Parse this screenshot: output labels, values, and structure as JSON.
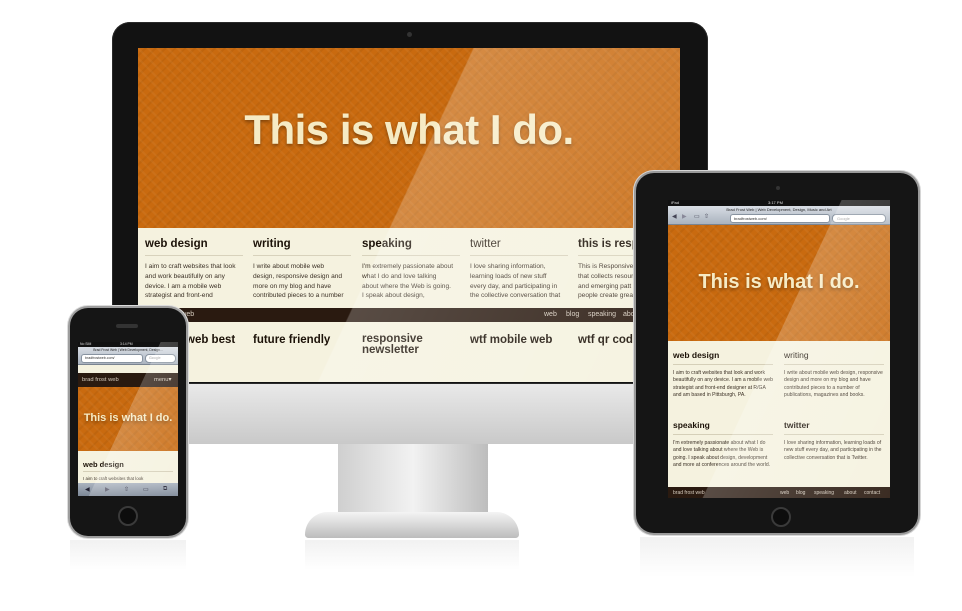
{
  "hero_text": "This is what I do.",
  "desktop": {
    "columns": [
      {
        "title": "web design",
        "lines": [
          "I aim to craft websites that look",
          "and work beautifully on any",
          "device. I am a mobile web",
          "strategist and front-end"
        ]
      },
      {
        "title": "writing",
        "lines": [
          "I write about mobile web",
          "design, responsive design and",
          "more on my blog and have",
          "contributed pieces to a number"
        ]
      },
      {
        "title": "speaking",
        "lines": [
          "I'm extremely passionate about",
          "what I do and love talking",
          "about where the Web is going.",
          "I speak about design,"
        ]
      },
      {
        "title": "twitter",
        "lines": [
          "I love sharing information,",
          "learning loads of new stuff",
          "every day, and participating in",
          "the collective conversation that"
        ]
      },
      {
        "title": "this is resp",
        "lines": [
          "This is Responsive",
          "that collects resourc",
          "and emerging patt",
          "people create great"
        ]
      }
    ],
    "nav_brand": "ost web",
    "nav_links": [
      "web",
      "blog",
      "speaking",
      "abo"
    ],
    "lower_headings": [
      "web best",
      "future friendly",
      "responsive newsletter",
      "wtf mobile web",
      "wtf qr code"
    ]
  },
  "ipad": {
    "status_left": "iPad",
    "status_time": "3:17 PM",
    "page_title": "Brad Frost Web | Web Development, Design, Music and Art",
    "url": "bradfrostweb.com/",
    "search_placeholder": "Google",
    "sections": [
      {
        "title": "web design",
        "text": "I aim to craft websites that look and work beautifully on any device. I am a mobile web strategist and front-end designer at R/GA and am based in Pittsburgh, PA."
      },
      {
        "title": "writing",
        "text": "I write about mobile web design, responsive design and more on my blog and have contributed pieces to a number of publications, magazines and books."
      },
      {
        "title": "speaking",
        "text": "I'm extremely passionate about what I do and love talking about where the Web is going. I speak about design, development and more at conferences around the world."
      },
      {
        "title": "twitter",
        "text": "I love sharing information, learning loads of new stuff every day, and participating in the collective conversation that is Twitter."
      }
    ],
    "nav_brand": "brad frost web",
    "nav_links": [
      "web",
      "blog",
      "speaking",
      "about",
      "contact"
    ]
  },
  "iphone": {
    "status_left": "No SIM",
    "status_time": "3:14 PM",
    "page_title": "Brad Frost Web | Web Development, Design...",
    "url": "bradfrostweb.com/",
    "search_placeholder": "Google",
    "brand": "brad frost web",
    "menu": "menu▾",
    "section_title": "web design",
    "section_text": "I aim to craft websites that look"
  },
  "colors": {
    "orange": "#c96a0f",
    "cream": "#f5f2df",
    "navbar": "#2a1a10",
    "hero_text": "#f6ebc4"
  }
}
